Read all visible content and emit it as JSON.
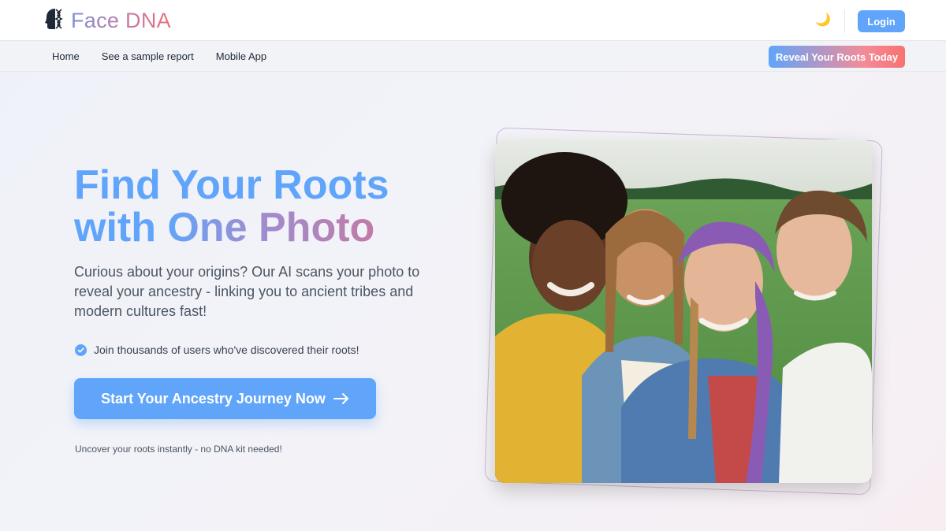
{
  "brand": {
    "name": "Face DNA",
    "logo_icon": "dna-face-icon",
    "gradient": [
      "#7b8fd6",
      "#c27aa8",
      "#e9707e"
    ]
  },
  "header": {
    "theme_icon": "moon-icon",
    "theme_glyph": "🌙",
    "login_label": "Login"
  },
  "nav": {
    "items": [
      {
        "label": "Home"
      },
      {
        "label": "See a sample report"
      },
      {
        "label": "Mobile App"
      }
    ],
    "reveal_label": "Reveal Your Roots Today"
  },
  "hero": {
    "title_line1": "Find Your Roots",
    "title_line2_prefix": "with ",
    "title_line2_highlight": "One Photo",
    "description": "Curious about your origins? Our AI scans your photo to reveal your ancestry - linking you to ancient tribes and modern cultures fast!",
    "check_text": "Join thousands of users who've discovered their roots!",
    "cta_label": "Start Your Ancestry Journey Now",
    "note": "Uncover your roots instantly - no DNA kit needed!"
  },
  "colors": {
    "accent": "#60a5fa",
    "pink": "#f87171"
  }
}
